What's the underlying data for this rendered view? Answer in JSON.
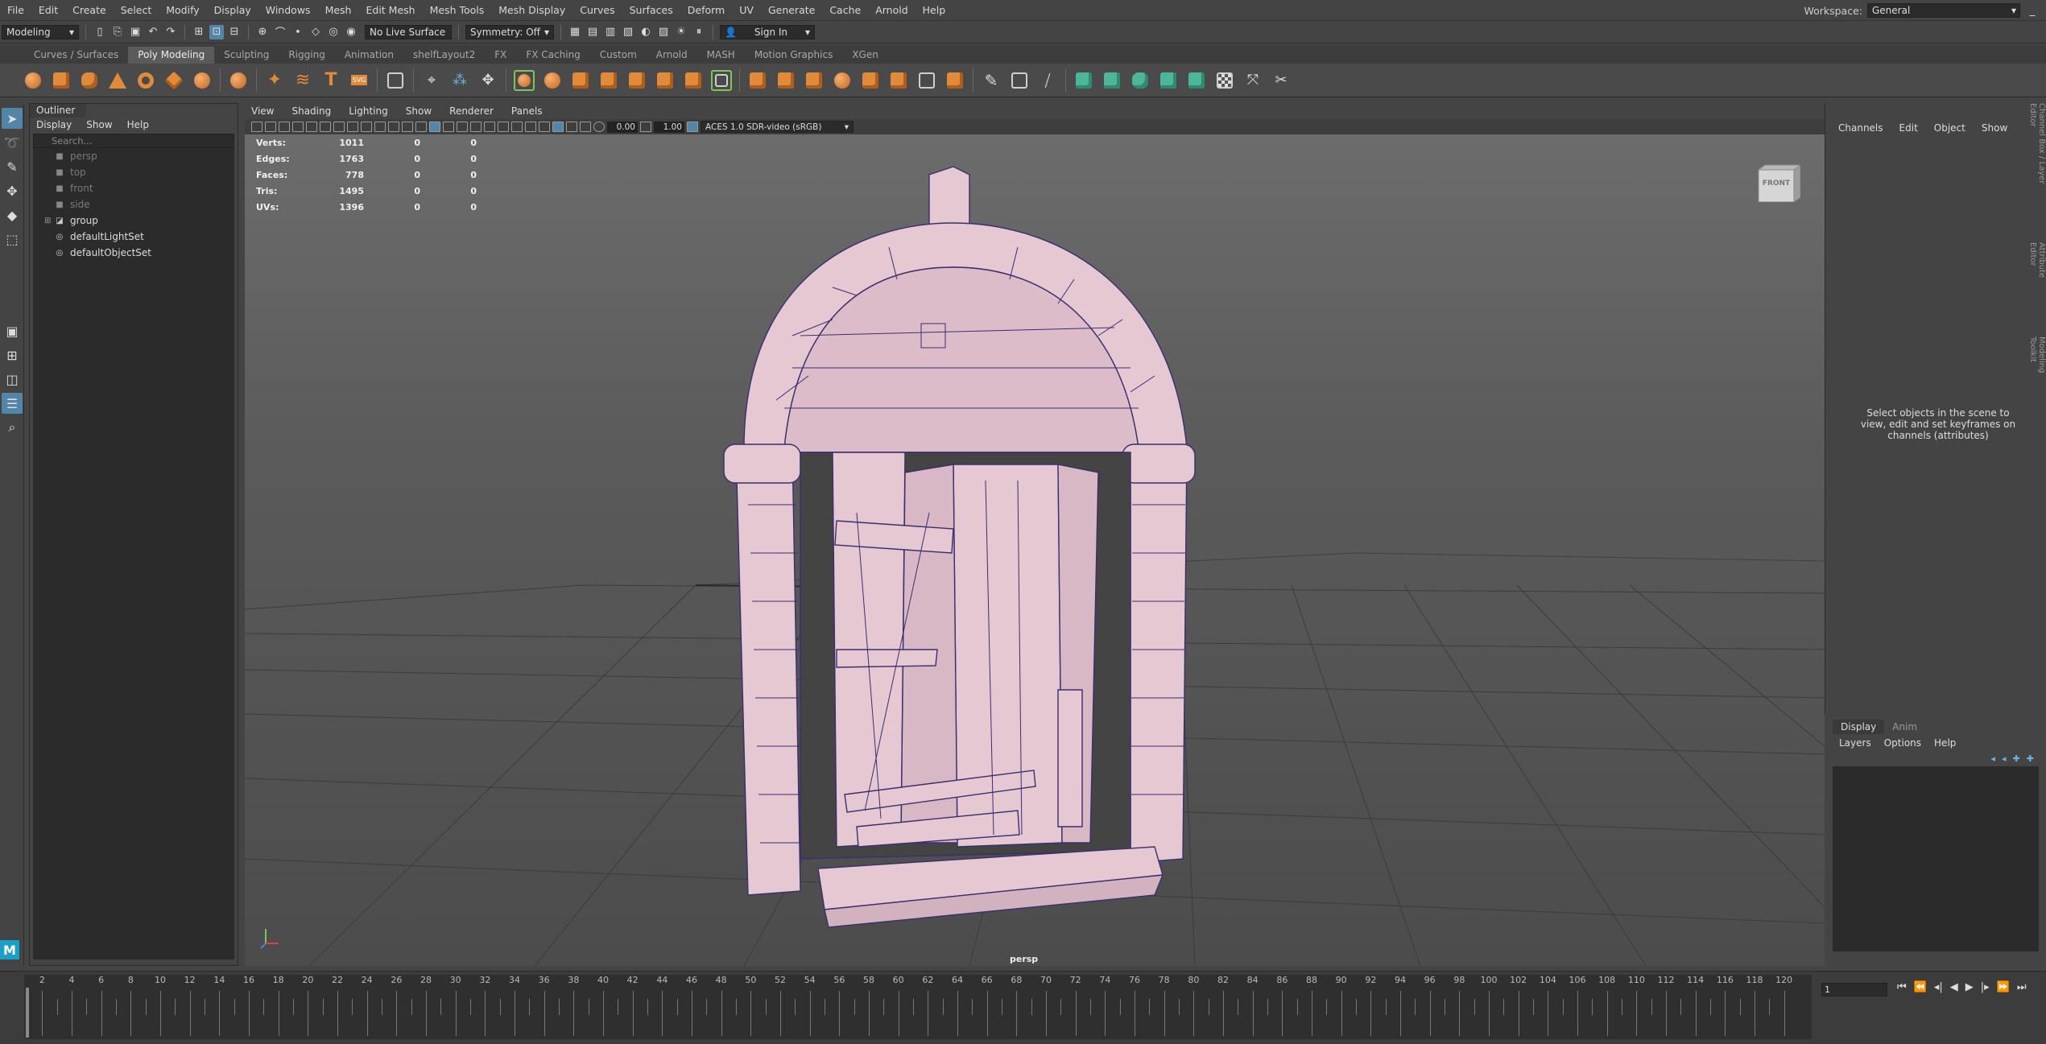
{
  "menubar": {
    "items": [
      "File",
      "Edit",
      "Create",
      "Select",
      "Modify",
      "Display",
      "Windows",
      "Mesh",
      "Edit Mesh",
      "Mesh Tools",
      "Mesh Display",
      "Curves",
      "Surfaces",
      "Deform",
      "UV",
      "Generate",
      "Cache",
      "Arnold",
      "Help"
    ],
    "workspace_label": "Workspace:",
    "workspace_value": "General"
  },
  "statusline": {
    "mode": "Modeling",
    "live_surface": "No Live Surface",
    "symmetry": "Symmetry: Off",
    "sign_in": "Sign In"
  },
  "shelf": {
    "tabs": [
      "Curves / Surfaces",
      "Poly Modeling",
      "Sculpting",
      "Rigging",
      "Animation",
      "shelfLayout2",
      "FX",
      "FX Caching",
      "Custom",
      "Arnold",
      "MASH",
      "Motion Graphics",
      "XGen"
    ],
    "active_tab": "Poly Modeling"
  },
  "outliner": {
    "title": "Outliner",
    "menu": [
      "Display",
      "Show",
      "Help"
    ],
    "search_placeholder": "Search...",
    "items": [
      {
        "label": "persp",
        "dim": true,
        "icon": "camera-icon"
      },
      {
        "label": "top",
        "dim": true,
        "icon": "camera-icon"
      },
      {
        "label": "front",
        "dim": true,
        "icon": "camera-icon"
      },
      {
        "label": "side",
        "dim": true,
        "icon": "camera-icon"
      },
      {
        "label": "group",
        "dim": false,
        "icon": "group-icon",
        "expandable": true
      },
      {
        "label": "defaultLightSet",
        "dim": false,
        "icon": "set-icon"
      },
      {
        "label": "defaultObjectSet",
        "dim": false,
        "icon": "set-icon"
      }
    ]
  },
  "viewport": {
    "menu": [
      "View",
      "Shading",
      "Lighting",
      "Show",
      "Renderer",
      "Panels"
    ],
    "exposure": "0.00",
    "gamma": "1.00",
    "color_space": "ACES 1.0 SDR-video (sRGB)",
    "hud": [
      {
        "label": "Verts:",
        "values": [
          "1011",
          "0",
          "0"
        ]
      },
      {
        "label": "Edges:",
        "values": [
          "1763",
          "0",
          "0"
        ]
      },
      {
        "label": "Faces:",
        "values": [
          "778",
          "0",
          "0"
        ]
      },
      {
        "label": "Tris:",
        "values": [
          "1495",
          "0",
          "0"
        ]
      },
      {
        "label": "UVs:",
        "values": [
          "1396",
          "0",
          "0"
        ]
      }
    ],
    "camera": "persp",
    "viewcube_label": "FRONT"
  },
  "channelbox": {
    "menu": [
      "Channels",
      "Edit",
      "Object",
      "Show"
    ],
    "hint": "Select objects in the scene to view, edit and set keyframes on channels (attributes)",
    "side_tabs": [
      "Channel Box / Layer Editor",
      "Attribute Editor",
      "Modeling Toolkit"
    ]
  },
  "layers": {
    "tabs": [
      "Display",
      "Anim"
    ],
    "menu": [
      "Layers",
      "Options",
      "Help"
    ]
  },
  "timeline": {
    "ticks": [
      "2",
      "4",
      "6",
      "8",
      "10",
      "12",
      "14",
      "16",
      "18",
      "20",
      "22",
      "24",
      "26",
      "28",
      "30",
      "32",
      "34",
      "36",
      "38",
      "40",
      "42",
      "44",
      "46",
      "48",
      "50",
      "52",
      "54",
      "56",
      "58",
      "60",
      "62",
      "64",
      "66",
      "68",
      "70",
      "72",
      "74",
      "76",
      "78",
      "80",
      "82",
      "84",
      "86",
      "88",
      "90",
      "92",
      "94",
      "96",
      "98",
      "100",
      "102",
      "104",
      "106",
      "108",
      "110",
      "112",
      "114",
      "116",
      "118",
      "120"
    ],
    "current_frame": "1"
  },
  "colors": {
    "accent": "#5285a6",
    "mesh": "#e6c8d2",
    "wire": "#3a2f6e",
    "shelf_icon": "#e08a3c"
  }
}
